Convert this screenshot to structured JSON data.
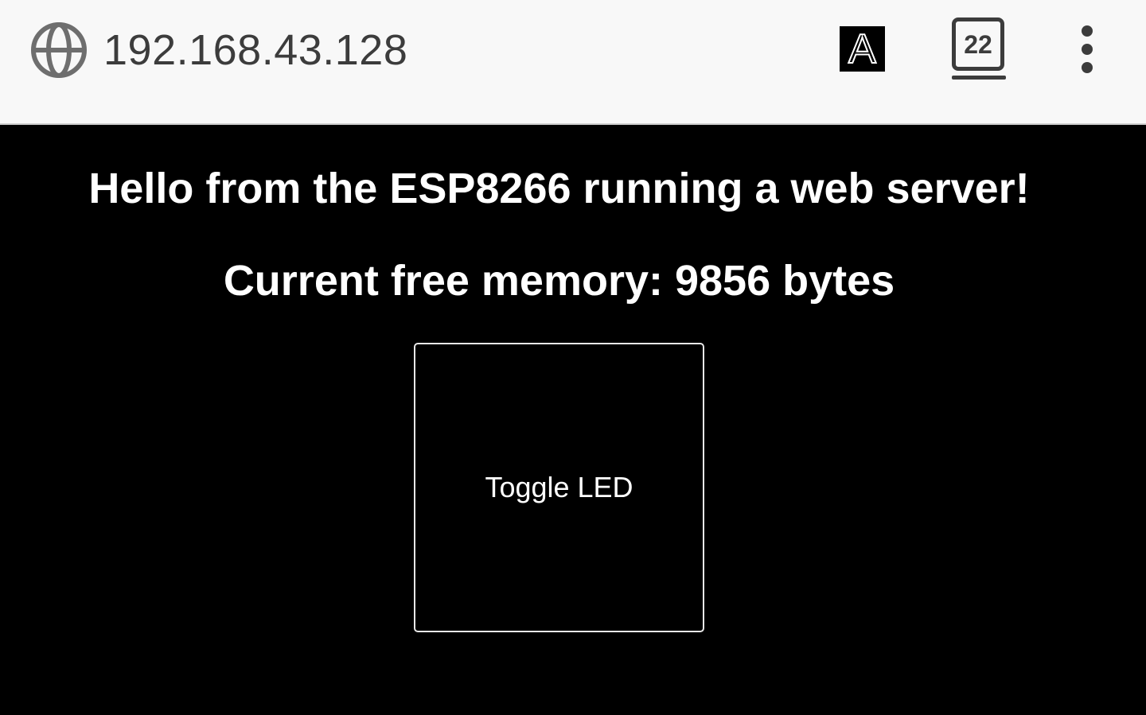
{
  "browser": {
    "url": "192.168.43.128",
    "translate_label": "A",
    "tab_count": "22",
    "icons": {
      "site": "globe-icon",
      "translate": "translate-icon",
      "tabs": "tabs-icon",
      "menu": "more-vert-icon"
    }
  },
  "page": {
    "greeting": "Hello from the ESP8266 running a web server!",
    "memory_text": "Current free memory: 9856 bytes",
    "toggle_label": "Toggle LED"
  },
  "colors": {
    "toolbar_bg": "#f8f8f8",
    "page_bg": "#000000",
    "text": "#ffffff",
    "icon": "#3c3c3c"
  }
}
